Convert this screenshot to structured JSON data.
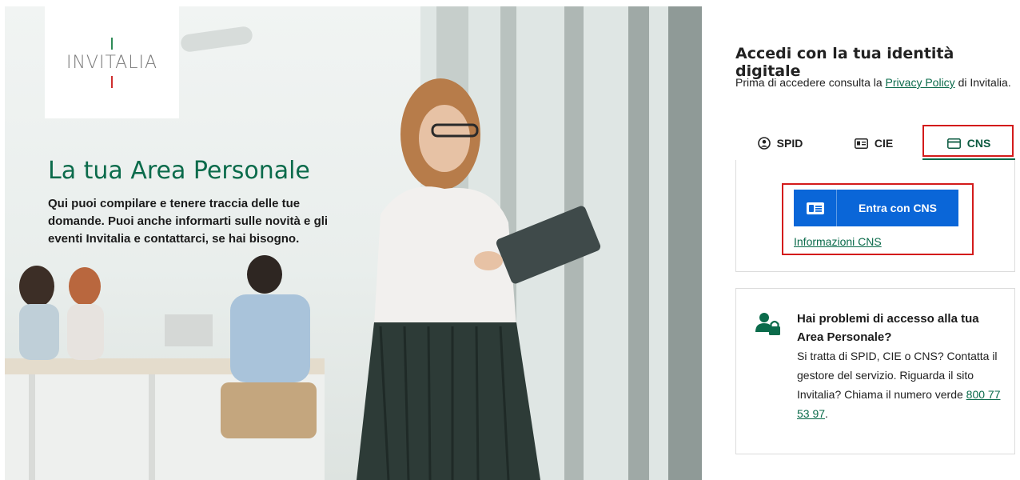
{
  "hero": {
    "logo_text": "INVITALIA",
    "title": "La tua Area Personale",
    "text": "Qui puoi compilare e tenere traccia delle tue domande. Puoi anche informarti sulle novità e gli eventi Invitalia e contattarci, se hai bisogno."
  },
  "login": {
    "title": "Accedi con la tua identità digitale",
    "intro_before": "Prima di accedere consulta la ",
    "privacy_link": "Privacy Policy",
    "intro_after": " di Invitalia.",
    "tabs": [
      {
        "label": "SPID",
        "icon": "user-circle-icon"
      },
      {
        "label": "CIE",
        "icon": "id-card-icon"
      },
      {
        "label": "CNS",
        "icon": "card-icon",
        "active": true
      }
    ],
    "cns_button": "Entra con CNS",
    "cns_info_link": "Informazioni CNS"
  },
  "help": {
    "icon": "user-lock-icon",
    "title": "Hai problemi di accesso alla tua Area Personale?",
    "body_line": "Si tratta di SPID, CIE o CNS? Contatta il gestore del servizio. Riguarda il sito Invitalia? Chiama il numero verde ",
    "phone": "800 77 53 97",
    "body_end": "."
  },
  "colors": {
    "brand_green": "#0b6b4b",
    "button_blue": "#0a66d8",
    "highlight_red": "#d31b1b"
  }
}
